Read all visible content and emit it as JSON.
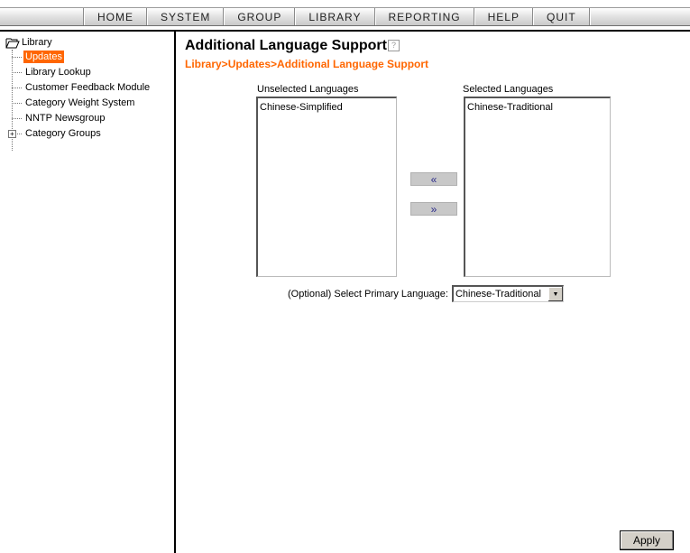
{
  "nav": {
    "items": [
      {
        "label": "HOME"
      },
      {
        "label": "SYSTEM"
      },
      {
        "label": "GROUP"
      },
      {
        "label": "LIBRARY"
      },
      {
        "label": "REPORTING"
      },
      {
        "label": "HELP"
      },
      {
        "label": "QUIT"
      }
    ]
  },
  "sidebar": {
    "root": {
      "label": "Library",
      "icon": "open-folder-icon"
    },
    "items": [
      {
        "label": "Updates",
        "selected": true
      },
      {
        "label": "Library Lookup"
      },
      {
        "label": "Customer Feedback Module"
      },
      {
        "label": "Category Weight System"
      },
      {
        "label": "NNTP Newsgroup"
      },
      {
        "label": "Category Groups",
        "expander": "+"
      }
    ]
  },
  "main": {
    "title": "Additional Language Support",
    "help_icon": "?",
    "breadcrumb": "Library>Updates>Additional Language Support",
    "unselected": {
      "label": "Unselected Languages",
      "options": [
        "Chinese-Simplified"
      ]
    },
    "selected": {
      "label": "Selected Languages",
      "options": [
        "Chinese-Traditional"
      ]
    },
    "move_left_label": "«",
    "move_right_label": "»",
    "primary": {
      "label": "(Optional) Select Primary Language:",
      "value": "Chinese-Traditional"
    },
    "apply_label": "Apply"
  },
  "colors": {
    "accent": "#ff6600",
    "selected_bg": "#ff6600"
  }
}
